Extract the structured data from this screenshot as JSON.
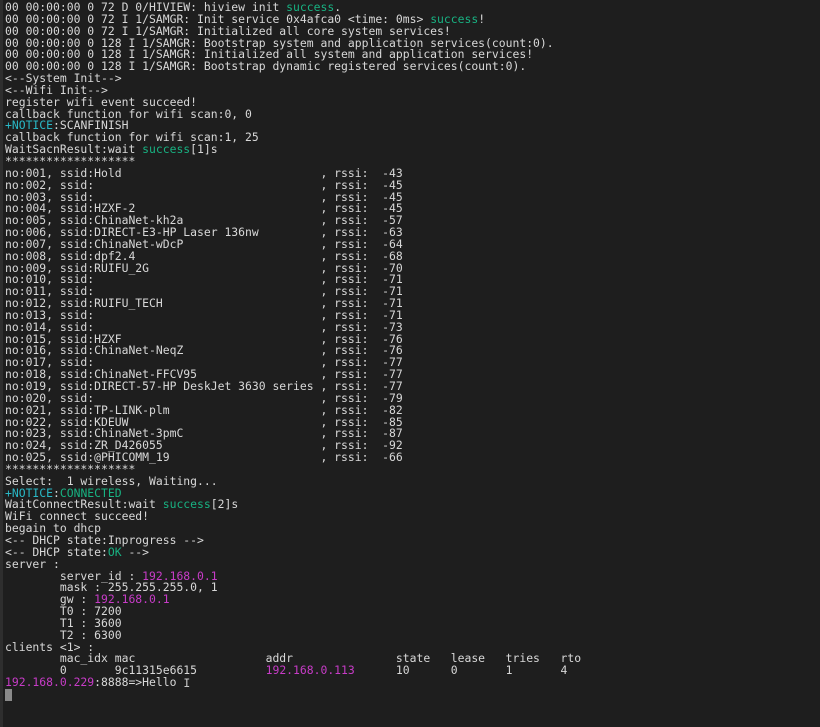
{
  "terminal": {
    "background_color": "#1e1e1e",
    "default_text_color": "#d8d8d8",
    "green_color": "#18b282",
    "cyan_color": "#29b8c6",
    "magenta_color": "#c73cc7",
    "separator": "*******************",
    "boot_log": [
      {
        "prefix": "00 00:00:00 0 72 D 0/HIVIEW: hiview init ",
        "highlight": "success",
        "highlight_color": "green",
        "suffix": "."
      },
      {
        "prefix": "00 00:00:00 0 72 I 1/SAMGR: Init service 0x4afca0 <time: 0ms> ",
        "highlight": "success",
        "highlight_color": "green",
        "suffix": "!"
      },
      {
        "prefix": "00 00:00:00 0 72 I 1/SAMGR: Initialized all core system services!",
        "highlight": "",
        "suffix": ""
      },
      {
        "prefix": "00 00:00:00 0 128 I 1/SAMGR: Bootstrap system and application services(count:0).",
        "highlight": "",
        "suffix": ""
      },
      {
        "prefix": "00 00:00:00 0 128 I 1/SAMGR: Initialized all system and application services!",
        "highlight": "",
        "suffix": ""
      },
      {
        "prefix": "00 00:00:00 0 128 I 1/SAMGR: Bootstrap dynamic registered services(count:0).",
        "highlight": "",
        "suffix": ""
      }
    ],
    "markers": {
      "system_init": "<--System Init-->",
      "wifi_init": "<--Wifi Init-->",
      "dhcp_inprogress_prefix": "<-- DHCP state:Inprogress -->",
      "dhcp_ok_prefix": "<-- DHCP state:",
      "dhcp_ok_value": "OK",
      "dhcp_ok_suffix": " -->"
    },
    "wifi_init_log": [
      "register wifi event succeed!",
      "callback function for wifi scan:0, 0"
    ],
    "notice_scanfinish": {
      "plus": "+",
      "tag": "NOTICE",
      "rest": ":SCANFINISH"
    },
    "scan_callback": "callback function for wifi scan:1, 25",
    "wait_scan_result": {
      "prefix": "WaitSacnResult:wait ",
      "highlight": "success",
      "suffix": "[1]s"
    },
    "scan_results": [
      {
        "no": "001",
        "ssid": "Hold",
        "rssi": "-43"
      },
      {
        "no": "002",
        "ssid": "",
        "rssi": "-45"
      },
      {
        "no": "003",
        "ssid": "",
        "rssi": "-45"
      },
      {
        "no": "004",
        "ssid": "HZXF-2",
        "rssi": "-45"
      },
      {
        "no": "005",
        "ssid": "ChinaNet-kh2a",
        "rssi": "-57"
      },
      {
        "no": "006",
        "ssid": "DIRECT-E3-HP Laser 136nw",
        "rssi": "-63"
      },
      {
        "no": "007",
        "ssid": "ChinaNet-wDcP",
        "rssi": "-64"
      },
      {
        "no": "008",
        "ssid": "dpf2.4",
        "rssi": "-68"
      },
      {
        "no": "009",
        "ssid": "RUIFU_2G",
        "rssi": "-70"
      },
      {
        "no": "010",
        "ssid": "",
        "rssi": "-71"
      },
      {
        "no": "011",
        "ssid": "",
        "rssi": "-71"
      },
      {
        "no": "012",
        "ssid": "RUIFU_TECH",
        "rssi": "-71"
      },
      {
        "no": "013",
        "ssid": "",
        "rssi": "-71"
      },
      {
        "no": "014",
        "ssid": "",
        "rssi": "-73"
      },
      {
        "no": "015",
        "ssid": "HZXF",
        "rssi": "-76"
      },
      {
        "no": "016",
        "ssid": "ChinaNet-NeqZ",
        "rssi": "-76"
      },
      {
        "no": "017",
        "ssid": "",
        "rssi": "-77"
      },
      {
        "no": "018",
        "ssid": "ChinaNet-FFCV95",
        "rssi": "-77"
      },
      {
        "no": "019",
        "ssid": "DIRECT-57-HP DeskJet 3630 series",
        "rssi": "-77"
      },
      {
        "no": "020",
        "ssid": "",
        "rssi": "-79"
      },
      {
        "no": "021",
        "ssid": "TP-LINK-plm",
        "rssi": "-82"
      },
      {
        "no": "022",
        "ssid": "KDEUW",
        "rssi": "-85"
      },
      {
        "no": "023",
        "ssid": "ChinaNet-3pmC",
        "rssi": "-87"
      },
      {
        "no": "024",
        "ssid": "ZR_D426055",
        "rssi": "-92"
      },
      {
        "no": "025",
        "ssid": "@PHICOMM_19",
        "rssi": "-66"
      }
    ],
    "select_line": "Select:  1 wireless, Waiting...",
    "notice_connected": {
      "plus": "+",
      "tag": "NOTICE",
      "colon": ":",
      "value": "CONNECTED"
    },
    "wait_connect_result": {
      "prefix": "WaitConnectResult:wait ",
      "highlight": "success",
      "suffix": "[2]s"
    },
    "connect_succeed": "WiFi connect succeed!",
    "begin_dhcp": "begain to dhcp",
    "server": {
      "label": "server :",
      "fields": [
        {
          "key": "server_id : ",
          "value": "192.168.0.1",
          "value_color": "magenta",
          "tail": ""
        },
        {
          "key": "mask : ",
          "value": "",
          "value_color": "white",
          "tail": "255.255.255.0, 1"
        },
        {
          "key": "gw : ",
          "value": "192.168.0.1",
          "value_color": "magenta",
          "tail": ""
        },
        {
          "key": "T0 : ",
          "value": "",
          "value_color": "white",
          "tail": "7200"
        },
        {
          "key": "T1 : ",
          "value": "",
          "value_color": "white",
          "tail": "3600"
        },
        {
          "key": "T2 : ",
          "value": "",
          "value_color": "white",
          "tail": "6300"
        }
      ]
    },
    "clients": {
      "label": "clients <1> :",
      "headers": [
        "mac_idx",
        "mac",
        "addr",
        "state",
        "lease",
        "tries",
        "rto"
      ],
      "rows": [
        {
          "mac_idx": "0",
          "mac": "9c11315e6615",
          "addr": "192.168.0.113",
          "state": "10",
          "lease": "0",
          "tries": "1",
          "rto": "4"
        }
      ]
    },
    "prompt": {
      "address": "192.168.0.229",
      "rest": ":8888=>Hello"
    }
  }
}
